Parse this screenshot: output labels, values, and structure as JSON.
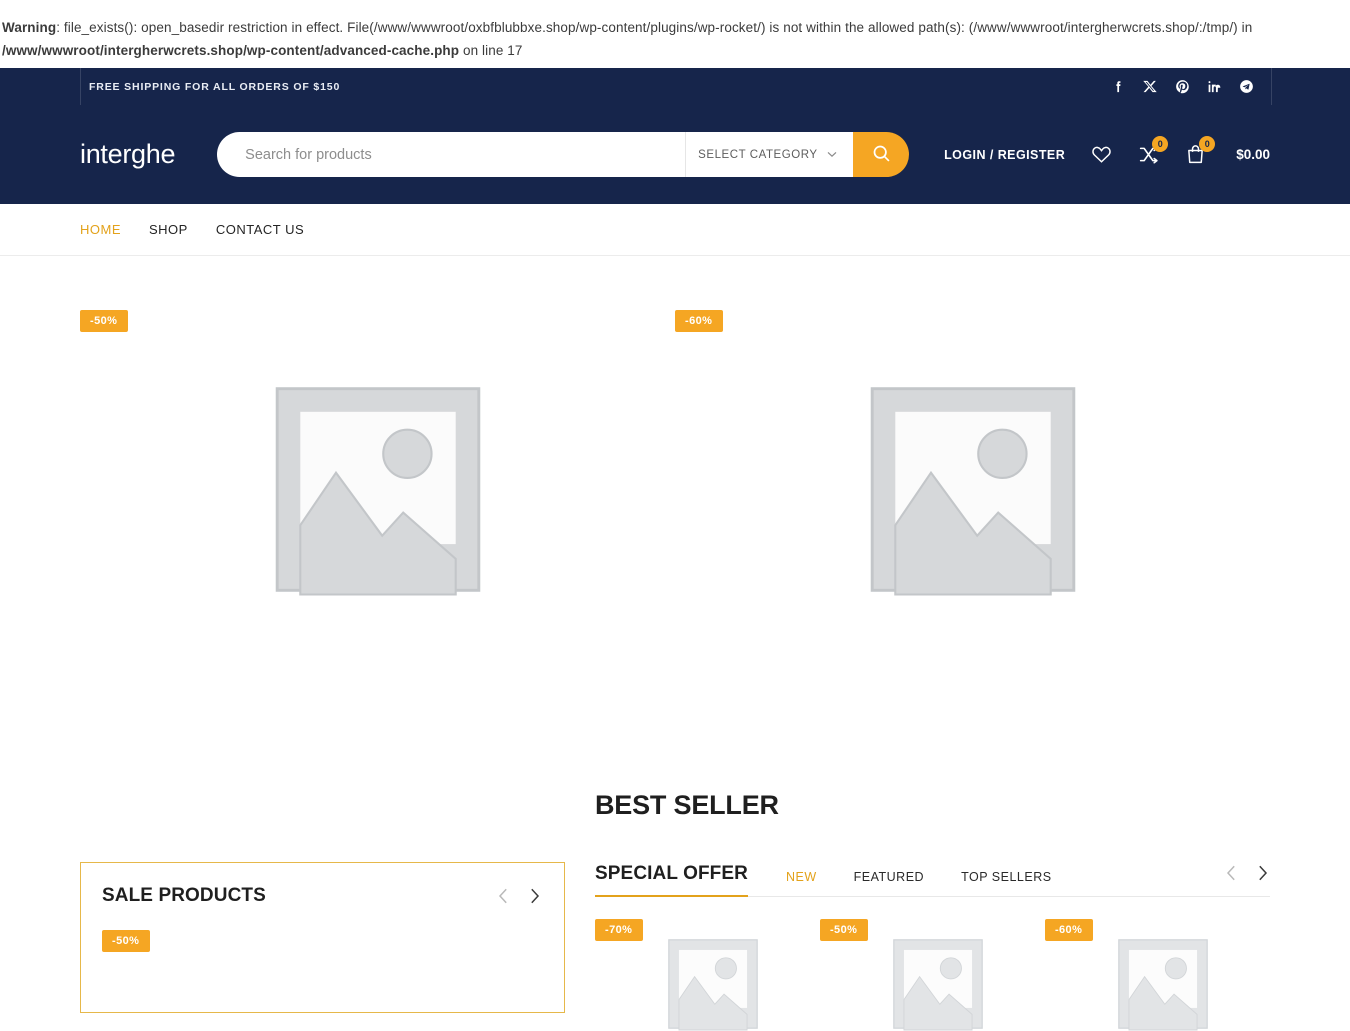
{
  "php_warning": {
    "label": "Warning",
    "line1": ": file_exists(): open_basedir restriction in effect. File(/www/wwwroot/oxbfblubbxe.shop/wp-content/plugins/wp-rocket/) is not within the allowed path(s): (/www/wwwroot/intergherwcrets.shop/:/tmp/) in",
    "path": "/www/wwwroot/intergherwcrets.shop/wp-content/advanced-cache.php",
    "line_suffix": " on line 17"
  },
  "topbar": {
    "shipping_note": "FREE SHIPPING FOR ALL ORDERS OF $150",
    "social": [
      {
        "name": "facebook-icon"
      },
      {
        "name": "x-twitter-icon"
      },
      {
        "name": "pinterest-icon"
      },
      {
        "name": "linkedin-icon"
      },
      {
        "name": "telegram-icon"
      }
    ]
  },
  "header": {
    "logo": "interghe",
    "search": {
      "placeholder": "Search for products",
      "value": "",
      "category_label": "SELECT CATEGORY",
      "submit_icon": "search-icon"
    },
    "login_label": "LOGIN / REGISTER",
    "wishlist_icon": "heart-icon",
    "compare_icon": "compare-icon",
    "compare_count": "0",
    "cart_icon": "cart-bag-icon",
    "cart_count": "0",
    "cart_total": "$0.00"
  },
  "nav": {
    "items": [
      {
        "label": "HOME",
        "active": true
      },
      {
        "label": "SHOP",
        "active": false
      },
      {
        "label": "CONTACT US",
        "active": false
      }
    ]
  },
  "hero_products": [
    {
      "badge": "-50%",
      "image": "product-placeholder"
    },
    {
      "badge": "-60%",
      "image": "product-placeholder"
    }
  ],
  "best_seller_title": "BEST SELLER",
  "sale_panel": {
    "title": "SALE PRODUCTS",
    "prev_icon": "chevron-left-icon",
    "next_icon": "chevron-right-icon",
    "products": [
      {
        "badge": "-50%"
      }
    ]
  },
  "offer_panel": {
    "title": "SPECIAL OFFER",
    "tabs": [
      {
        "label": "NEW",
        "active": true
      },
      {
        "label": "FEATURED",
        "active": false
      },
      {
        "label": "TOP SELLERS",
        "active": false
      }
    ],
    "prev_icon": "chevron-left-icon",
    "next_icon": "chevron-right-icon",
    "products": [
      {
        "badge": "-70%"
      },
      {
        "badge": "-50%"
      },
      {
        "badge": "-60%"
      }
    ]
  },
  "colors": {
    "header_navy": "#16254b",
    "accent_orange": "#f5a623",
    "accent_gold": "#e3a21b",
    "text_dark": "#1f1f1f"
  }
}
